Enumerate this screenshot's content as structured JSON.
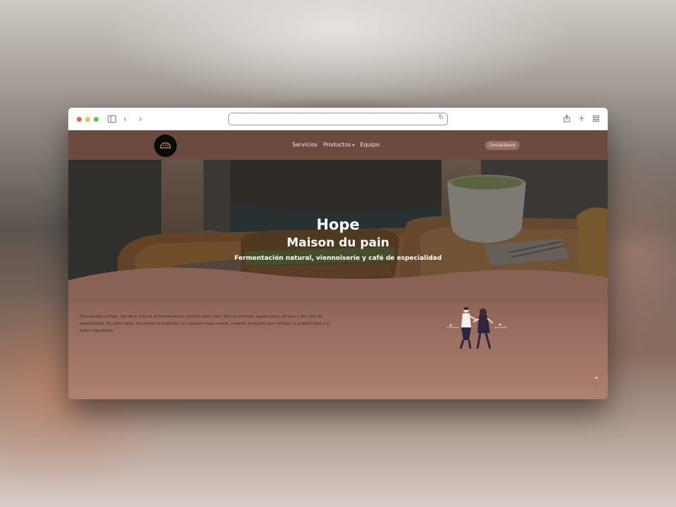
{
  "browser": {
    "back_icon": "chevron-left",
    "forward_icon": "chevron-right",
    "reload_icon": "reload",
    "share_icon": "share",
    "new_tab_icon": "plus",
    "tabs_icon": "grid"
  },
  "navbar": {
    "links": [
      "Servicios",
      "Productos",
      "Equipo"
    ],
    "dropdown_caret": "▾",
    "contact_label": "Contáctanos"
  },
  "hero": {
    "title": "Hope",
    "subtitle": "Maison du pain",
    "tagline": "Fermentación natural, viennoiserie y café de especialidad"
  },
  "intro": {
    "text": "Bienvenidos a Hope, donde el arte de la fermentación natural cobra vida. Somos amantes apasionados del pan y del café de especialidad. En cada masa, honramos la tradición con nuestra masa madre, creando productos que reflejan la autenticidad y el sabor inigualable."
  },
  "scroll_top": {
    "icon": "chevron-up",
    "glyph": "⌃"
  },
  "colors": {
    "navbar": "#6b4b40",
    "content": "#9c7062",
    "button": "#9a6f63"
  }
}
